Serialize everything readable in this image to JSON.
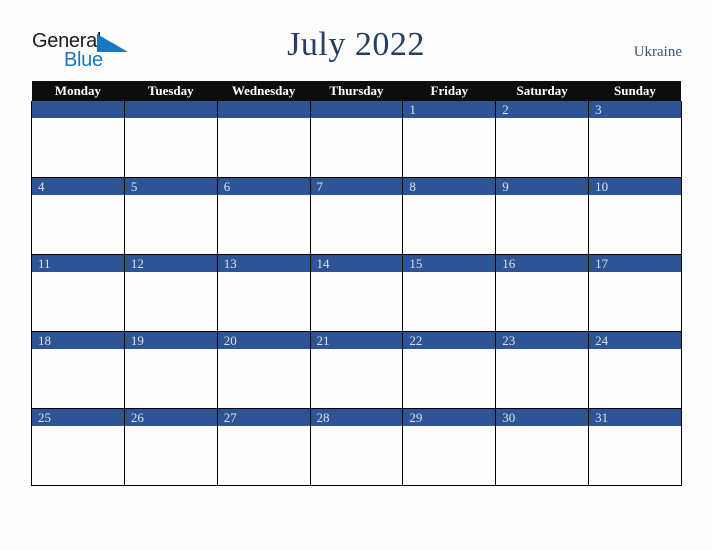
{
  "brand": {
    "name_part1": "General",
    "name_part2": "Blue",
    "triangle_color": "#1878bd",
    "text_color": "#1b1b1b",
    "blue_color": "#1878bd"
  },
  "header": {
    "title": "July 2022",
    "country": "Ukraine",
    "title_color": "#27405f",
    "country_color": "#3d5576"
  },
  "calendar": {
    "weekday_headers": [
      "Monday",
      "Tuesday",
      "Wednesday",
      "Thursday",
      "Friday",
      "Saturday",
      "Sunday"
    ],
    "header_bg": "#0d0d0d",
    "header_fg": "#ffffff",
    "daybar_bg": "#2f5496",
    "daybar_fg": "#d9e0ea",
    "cell_bg": "#fdfdfd",
    "grid_color": "#000000",
    "weeks": [
      [
        "",
        "",
        "",
        "",
        "1",
        "2",
        "3"
      ],
      [
        "4",
        "5",
        "6",
        "7",
        "8",
        "9",
        "10"
      ],
      [
        "11",
        "12",
        "13",
        "14",
        "15",
        "16",
        "17"
      ],
      [
        "18",
        "19",
        "20",
        "21",
        "22",
        "23",
        "24"
      ],
      [
        "25",
        "26",
        "27",
        "28",
        "29",
        "30",
        "31"
      ]
    ]
  }
}
